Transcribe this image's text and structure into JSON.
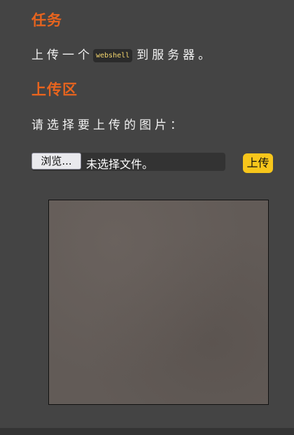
{
  "task": {
    "heading": "任务",
    "text_before": "上传一个",
    "code": "webshell",
    "text_after": "到服务器。"
  },
  "upload": {
    "heading": "上传区",
    "prompt": "请选择要上传的图片：",
    "browse_label": "浏览...",
    "file_status": "未选择文件。",
    "submit_label": "上传"
  }
}
